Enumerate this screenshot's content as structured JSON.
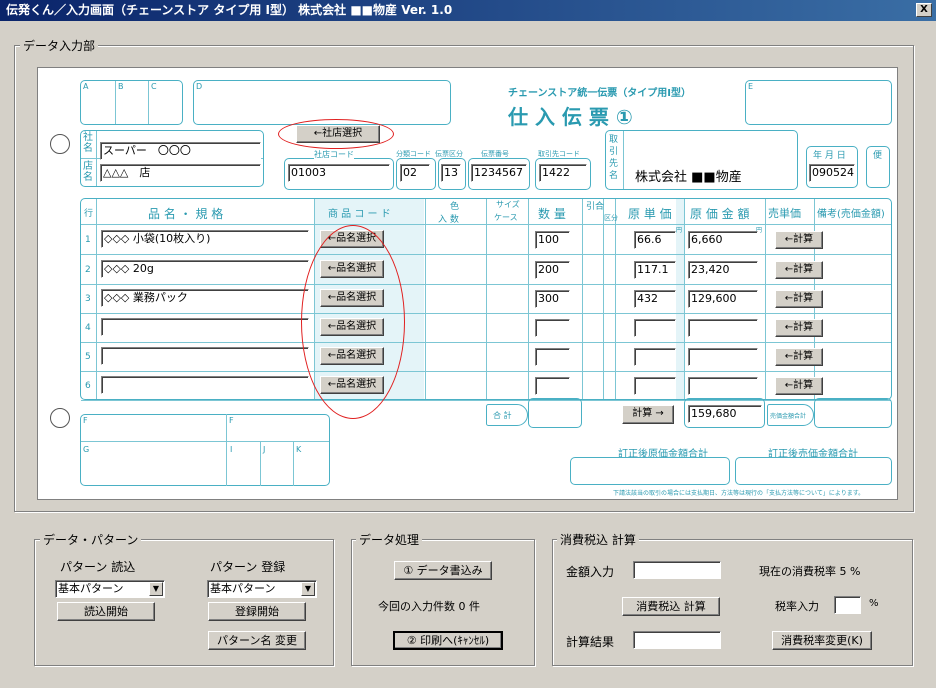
{
  "window": {
    "title": "伝発くん／入力画面（チェーンストア タイプ用 Ⅰ型） 株式会社 ■■物産 Ver. 1.0",
    "close": "X"
  },
  "data_input": {
    "group_title": "データ入力部"
  },
  "slip": {
    "box_a": "A",
    "box_b": "B",
    "box_c": "C",
    "box_d": "D",
    "box_e": "E",
    "header_sub": "チェーンストア統一伝票（タイプ用Ⅰ型）",
    "header_title": "仕 入 伝 票 ①",
    "store_select_btn": "←社店選択",
    "company_label": "社名",
    "store_label": "店名",
    "company_value": "スーパー　〇〇〇",
    "store_value": "△△△　店",
    "company_code_label": "社店コード",
    "company_code_value": "01003",
    "class_code_label": "分類コード",
    "class_code_value": "02",
    "slip_class_label": "伝票区分",
    "slip_class_value": "13",
    "slip_no_label": "伝票番号",
    "slip_no_value": "1234567",
    "vendor_code_label": "取引先コード",
    "vendor_code_value": "1422",
    "vendor_label": "取引先名",
    "vendor_value": "株式会社 ■■物産",
    "date_label": "年 月 日",
    "date_value": "090524",
    "bin_label": "便",
    "col_line": "行",
    "col_name": "品 名 ・ 規 格",
    "col_code": "商 品 コ ー ド",
    "col_color": "色",
    "col_size": "サイズ",
    "col_irisu": "入 数",
    "col_case": "ケース",
    "col_qty": "数 量",
    "col_hikiai": "引合",
    "col_kubun": "区分",
    "col_unit_cost": "原 単 価",
    "col_cost_amount": "原 価 金 額",
    "col_sell_price": "売単価",
    "col_remarks": "備考(売価金額)",
    "yen1": "円",
    "yen2": "円",
    "rows": [
      {
        "no": "1",
        "name": "◇◇◇ 小袋(10枚入り)",
        "select": "←品名選択",
        "qty": "100",
        "unit": "66.6",
        "amount": "6,660",
        "calc": "←計算"
      },
      {
        "no": "2",
        "name": "◇◇◇ 20g",
        "select": "←品名選択",
        "qty": "200",
        "unit": "117.1",
        "amount": "23,420",
        "calc": "←計算"
      },
      {
        "no": "3",
        "name": "◇◇◇ 業務パック",
        "select": "←品名選択",
        "qty": "300",
        "unit": "432",
        "amount": "129,600",
        "calc": "←計算"
      },
      {
        "no": "4",
        "name": "",
        "select": "←品名選択",
        "qty": "",
        "unit": "",
        "amount": "",
        "calc": "←計算"
      },
      {
        "no": "5",
        "name": "",
        "select": "←品名選択",
        "qty": "",
        "unit": "",
        "amount": "",
        "calc": "←計算"
      },
      {
        "no": "6",
        "name": "",
        "select": "←品名選択",
        "qty": "",
        "unit": "",
        "amount": "",
        "calc": "←計算"
      }
    ],
    "total_label": "合 計",
    "calc_btn": "計算 →",
    "total_value": "159,680",
    "sell_total_label": "売価金額合計",
    "box_f": "F",
    "box_f2": "F",
    "box_g": "G",
    "box_i": "I",
    "box_j": "J",
    "box_k": "K",
    "corr_cost_label": "訂正後原価金額合計",
    "corr_sell_label": "訂正後売価金額合計",
    "footnote": "下請法該当の取引の場合には支払期日、方法等は現行の「支払方法等について」によります。"
  },
  "pattern": {
    "title": "データ・パターン",
    "load_label": "パターン 読込",
    "save_label": "パターン 登録",
    "load_value": "基本パターン",
    "save_value": "基本パターン",
    "load_btn": "読込開始",
    "save_btn": "登録開始",
    "rename_btn": "パターン名 変更"
  },
  "process": {
    "title": "データ処理",
    "write_btn": "① データ書込み",
    "count_text": "今回の入力件数 0 件",
    "print_btn": "② 印刷へ(ｷｬﾝｾﾙ)"
  },
  "tax": {
    "title": "消費税込 計算",
    "amount_label": "金額入力",
    "amount_value": "",
    "current_rate_text": "現在の消費税率 5 %",
    "calc_btn": "消費税込 計算",
    "rate_label": "税率入力",
    "rate_value": "",
    "rate_unit": "%",
    "result_label": "計算結果",
    "result_value": "",
    "rate_change_btn": "消費税率変更(K)"
  }
}
